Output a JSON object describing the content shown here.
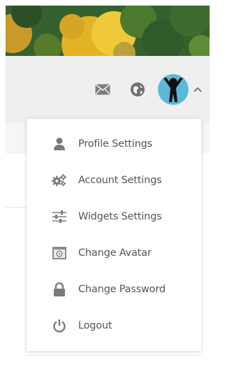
{
  "header": {
    "icons": [
      "mail-icon",
      "globe-icon",
      "chevron-up-icon"
    ],
    "avatar": "user-avatar"
  },
  "dropdown": {
    "items": [
      {
        "label": "Profile Settings",
        "icon": "user-icon"
      },
      {
        "label": "Account Settings",
        "icon": "gears-icon"
      },
      {
        "label": "Widgets Settings",
        "icon": "sliders-icon"
      },
      {
        "label": "Change Avatar",
        "icon": "image-icon"
      },
      {
        "label": "Change Password",
        "icon": "lock-icon"
      },
      {
        "label": "Logout",
        "icon": "power-icon"
      }
    ]
  },
  "colors": {
    "header_bg": "#efefef",
    "icon_gray": "#7a7a7a",
    "text": "#555555",
    "avatar_bg": "#5bb8d8"
  }
}
